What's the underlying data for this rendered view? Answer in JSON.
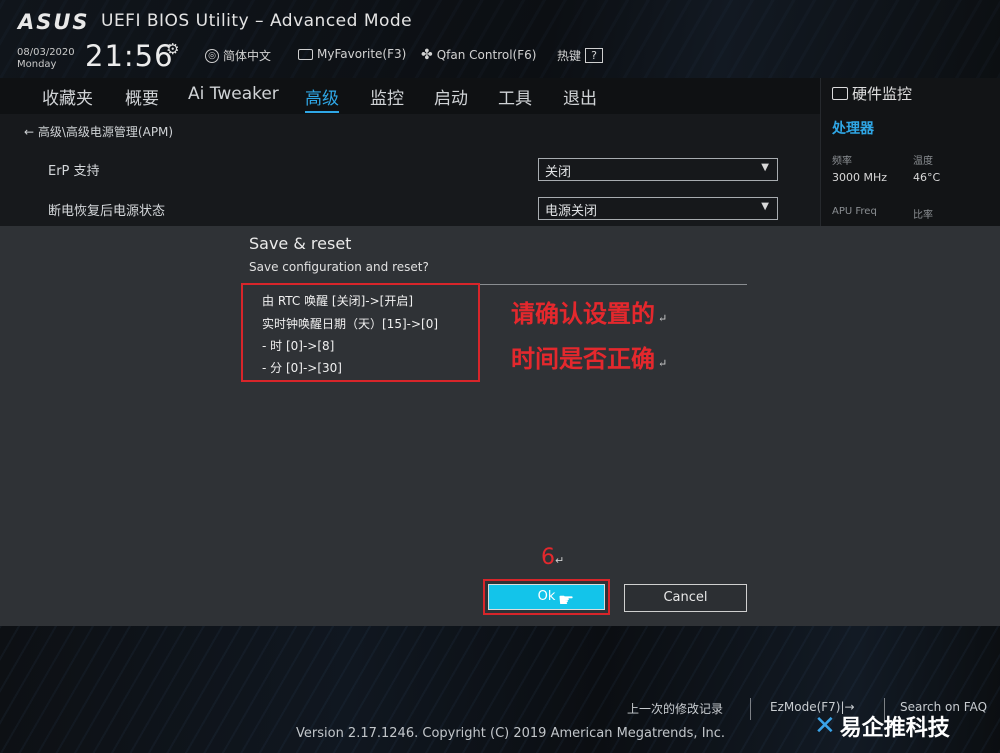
{
  "header": {
    "logo": "ASUS",
    "title": "UEFI BIOS Utility – Advanced Mode",
    "date": "08/03/2020",
    "weekday": "Monday",
    "time": "21:56",
    "language": "简体中文",
    "myfavorite": "MyFavorite(F3)",
    "qfan": "Qfan Control(F6)",
    "hotkeys": "热键",
    "hotkeys_badge": "?"
  },
  "nav": {
    "tabs": [
      "收藏夹",
      "概要",
      "Ai Tweaker",
      "高级",
      "监控",
      "启动",
      "工具",
      "退出"
    ],
    "active_index": 3
  },
  "content": {
    "breadcrumb": "高级\\高级电源管理(APM)",
    "settings": [
      {
        "label": "ErP 支持",
        "value": "关闭"
      },
      {
        "label": "断电恢复后电源状态",
        "value": "电源关闭"
      }
    ]
  },
  "hw_monitor": {
    "title": "硬件监控",
    "section": "处理器",
    "freq_label": "频率",
    "freq_value": "3000 MHz",
    "temp_label": "温度",
    "temp_value": "46°C",
    "apu_label": "APU Freq",
    "ratio_label": "比率"
  },
  "dialog": {
    "title": "Save & reset",
    "subtitle": "Save configuration and reset?",
    "changes": [
      "由 RTC 唤醒 [关闭]->[开启]",
      "实时钟唤醒日期（天）[15]->[0]",
      "- 时 [0]->[8]",
      "- 分 [0]->[30]"
    ],
    "note_lines": [
      "请确认设置的",
      "时间是否正确"
    ],
    "step": "6",
    "ok_label": "Ok",
    "cancel_label": "Cancel"
  },
  "footer": {
    "last_modified": "上一次的修改记录",
    "ezmode": "EzMode(F7)|→",
    "search_faq": "Search on FAQ",
    "version": "Version 2.17.1246. Copyright (C) 2019 American Megatrends, Inc.",
    "watermark": "易企推科技"
  },
  "colors": {
    "accent_blue": "#2fa7e6",
    "ok_cyan": "#13c4ea",
    "highlight_red": "#d8252a"
  }
}
